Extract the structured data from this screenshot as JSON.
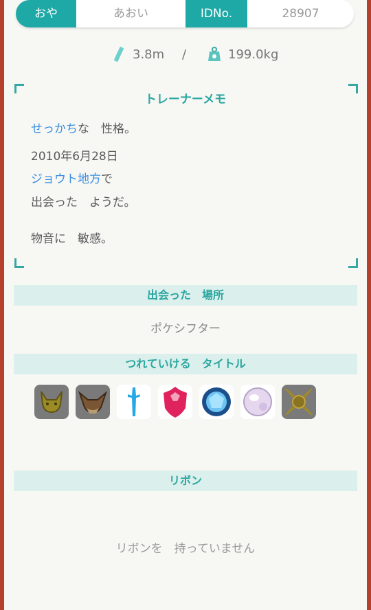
{
  "header": {
    "ot_label": "おや",
    "ot_name": "あおい",
    "id_label": "IDNo.",
    "id_value": "28907"
  },
  "stats": {
    "height": "3.8m",
    "separator": "/",
    "weight": "199.0kg"
  },
  "memo": {
    "title": "トレーナーメモ",
    "nature_word": "せっかち",
    "nature_rest": "な　性格。",
    "date": "2010年6月28日",
    "region": "ジョウト地方",
    "region_suffix": "で",
    "met_line": "出会った　ようだ。",
    "characteristic": "物音に　敏感。"
  },
  "met_location": {
    "header": "出会った　場所",
    "value": "ポケシフター"
  },
  "marks": {
    "header": "つれていける　タイトル",
    "items": [
      "pikachu-mark-icon",
      "eevee-mark-icon",
      "sword-mark-icon",
      "shield-mark-icon",
      "blue-gem-mark-icon",
      "pearl-mark-icon",
      "crossed-mark-icon"
    ]
  },
  "ribbons": {
    "header": "リボン",
    "empty_text": "リボンを　持っていません"
  },
  "colors": {
    "accent": "#1fa9a6",
    "highlight": "#3a8fe0",
    "band": "#dbefec",
    "frame": "#b5402c"
  }
}
